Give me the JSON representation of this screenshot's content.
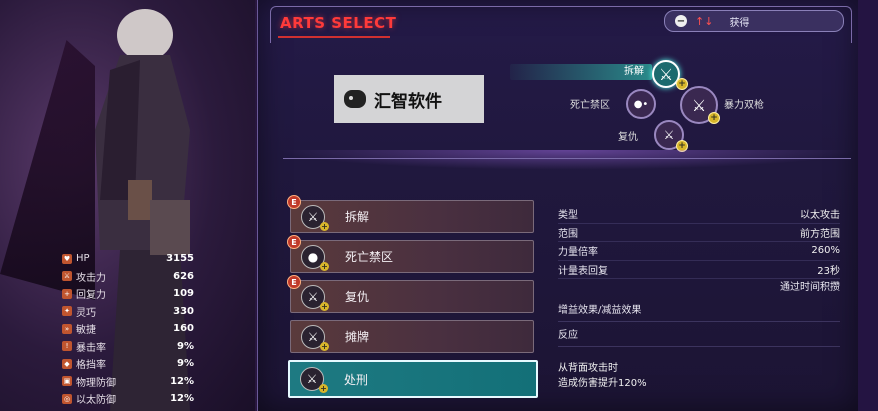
{
  "stats": [
    {
      "label": "HP",
      "value": "3155"
    },
    {
      "label": "攻击力",
      "value": "626"
    },
    {
      "label": "回复力",
      "value": "109"
    },
    {
      "label": "灵巧",
      "value": "330"
    },
    {
      "label": "敏捷",
      "value": "160"
    },
    {
      "label": "暴击率",
      "value": "9%"
    },
    {
      "label": "格挡率",
      "value": "9%"
    },
    {
      "label": "物理防御",
      "value": "12%"
    },
    {
      "label": "以太防御",
      "value": "12%"
    }
  ],
  "header": {
    "title": "ARTS SELECT",
    "sort_label": "获得",
    "sort_minus": "−",
    "sort_arrows": "↑↓"
  },
  "watermark": {
    "text": "汇智软件"
  },
  "tree": {
    "selected_label": "拆解",
    "nodes": [
      {
        "label": "死亡禁区"
      },
      {
        "label": "暴力双枪"
      },
      {
        "label": "复仇"
      }
    ]
  },
  "arts": [
    {
      "name": "拆解",
      "badge": "E",
      "icon": "sword-icon",
      "selected": false
    },
    {
      "name": "死亡禁区",
      "badge": "E",
      "icon": "orbs-icon",
      "selected": false
    },
    {
      "name": "复仇",
      "badge": "E",
      "icon": "sword-icon",
      "selected": false
    },
    {
      "name": "摊牌",
      "badge": "",
      "icon": "sword-icon",
      "selected": false
    },
    {
      "name": "处刑",
      "badge": "",
      "icon": "sword-icon",
      "selected": true
    }
  ],
  "details": {
    "rows": [
      {
        "k": "类型",
        "v": "以太攻击"
      },
      {
        "k": "范围",
        "v": "前方范围"
      },
      {
        "k": "力量倍率",
        "v": "260%"
      },
      {
        "k": "计量表回复",
        "v": "23秒"
      }
    ],
    "gauge_note": "通过时间积攒",
    "buff_label": "增益效果/减益效果",
    "reaction_label": "反应",
    "desc_line1": "从背面攻击时",
    "desc_line2": "造成伤害提升120%"
  },
  "colors": {
    "accent": "#ff3a3a",
    "selected_row": "#1e7a82",
    "badge": "#c03a2a"
  }
}
